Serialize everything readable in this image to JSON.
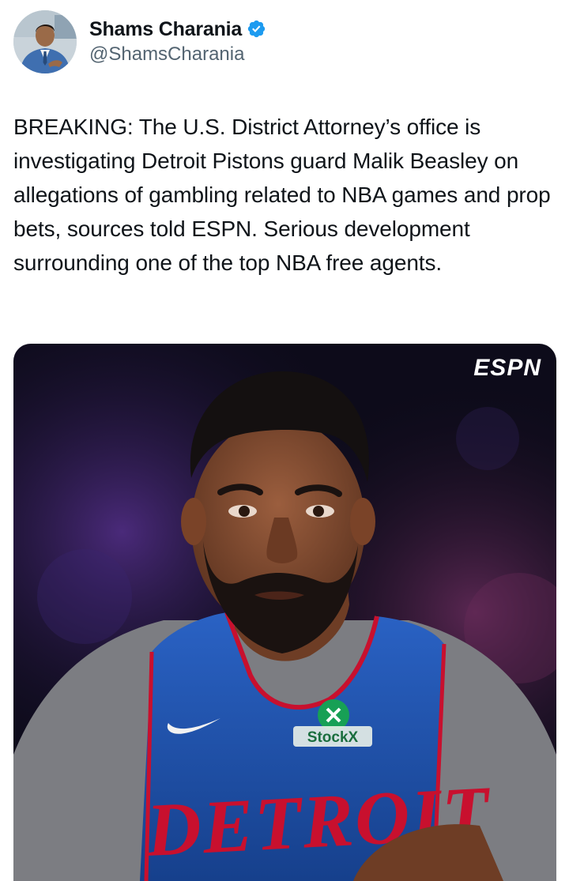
{
  "author": {
    "display_name": "Shams Charania",
    "handle": "@ShamsCharania",
    "verified": true,
    "verified_color": "#1d9bf0"
  },
  "tweet": {
    "text": "BREAKING: The U.S. District Attorney’s office is investigating Detroit Pistons guard Malik Beasley on allegations of gambling related to NBA games and prop bets, sources told ESPN. Serious development surrounding one of the top NBA free agents."
  },
  "media": {
    "watermark": "ESPN",
    "jersey_sponsor": "StockX",
    "jersey_wordmark": "DETROIT",
    "jersey_color": "#1d4ea8"
  }
}
